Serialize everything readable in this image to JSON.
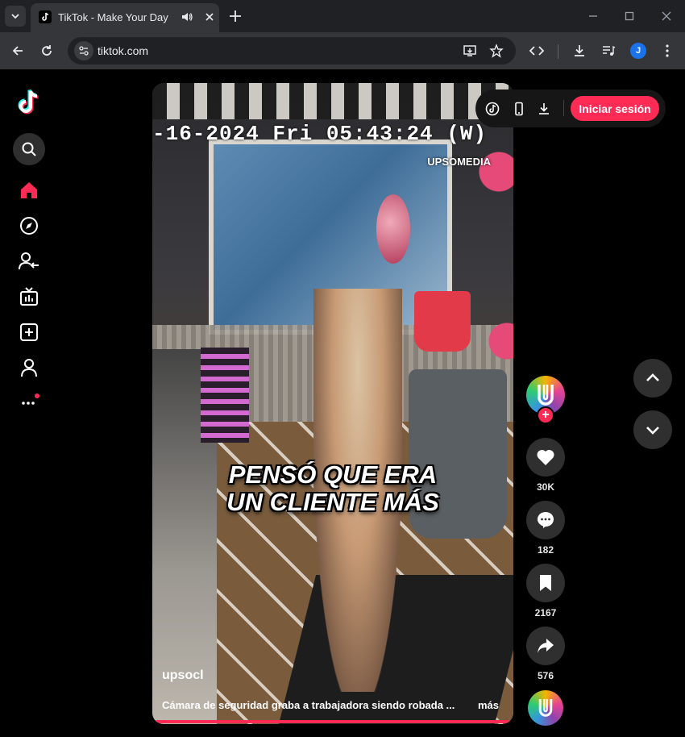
{
  "browser": {
    "tab_title": "TikTok - Make Your Day",
    "url": "tiktok.com",
    "profile_initial": "J"
  },
  "sidebar": {
    "items": [
      {
        "name": "home",
        "icon": "home-icon",
        "active": true
      },
      {
        "name": "explore",
        "icon": "compass-icon"
      },
      {
        "name": "following",
        "icon": "following-icon"
      },
      {
        "name": "live",
        "icon": "live-tv-icon"
      },
      {
        "name": "upload",
        "icon": "upload-plus-icon"
      },
      {
        "name": "profile",
        "icon": "profile-icon"
      },
      {
        "name": "more",
        "icon": "more-dots-icon"
      }
    ]
  },
  "top_controls": {
    "login_label": "Iniciar sesión"
  },
  "video": {
    "timestamp": "-16-2024 Fri 05:43:24 (W)",
    "watermark": "UPSOMEDIA",
    "caption_line1": "PENSÓ QUE ERA",
    "caption_line2": "UN CLIENTE MÁS",
    "author": "upsocl",
    "description": "Cámara de seguridad graba a trabajadora siendo robada ...",
    "more_label": "más"
  },
  "actions": {
    "likes": "30K",
    "comments": "182",
    "saves": "2167",
    "shares": "576"
  },
  "colors": {
    "accent": "#fe2c55",
    "background": "#000000",
    "chrome_dark": "#202124",
    "chrome_mid": "#35363a"
  }
}
